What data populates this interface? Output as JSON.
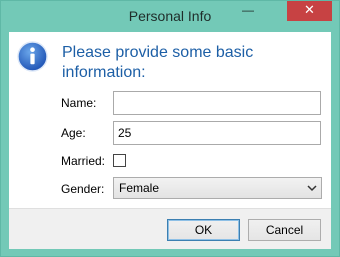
{
  "window": {
    "title": "Personal Info",
    "minimize_glyph": "—",
    "close_glyph": "✕"
  },
  "dialog": {
    "icon": "info-icon",
    "heading": "Please provide some basic information:"
  },
  "form": {
    "name": {
      "label": "Name:",
      "value": ""
    },
    "age": {
      "label": "Age:",
      "value": "25"
    },
    "married": {
      "label": "Married:",
      "checked": false
    },
    "gender": {
      "label": "Gender:",
      "selected": "Female"
    }
  },
  "buttons": {
    "ok": "OK",
    "cancel": "Cancel"
  },
  "colors": {
    "title_bar": "#73c9b7",
    "close_button": "#c74243",
    "heading_text": "#1d5fa6"
  }
}
